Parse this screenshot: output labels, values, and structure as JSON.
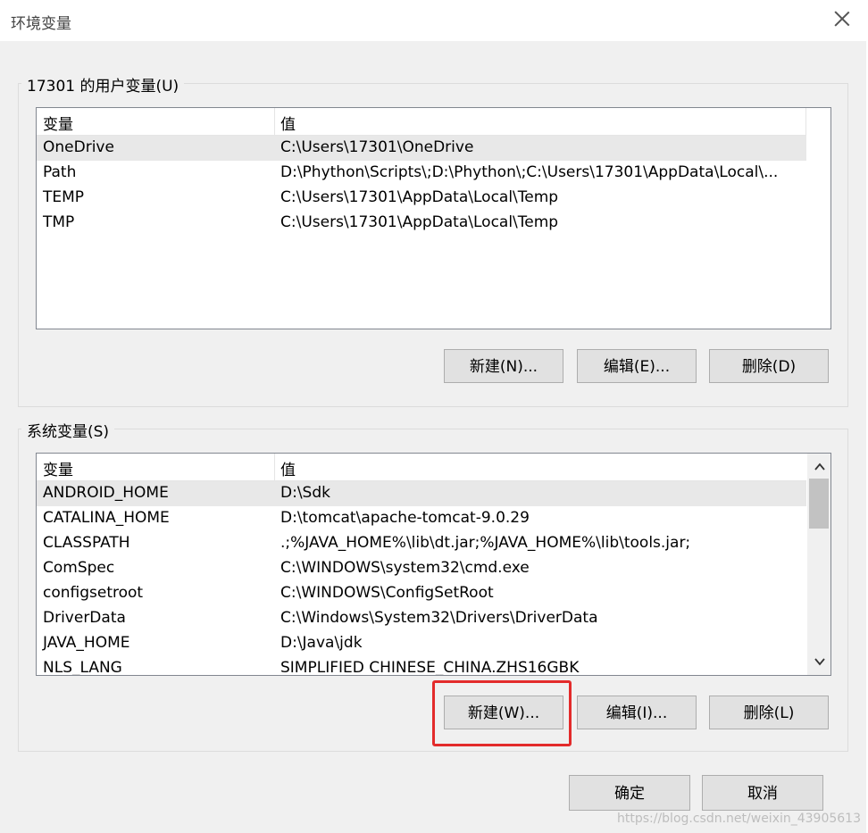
{
  "window": {
    "title": "环境变量"
  },
  "user_vars": {
    "group_label": "17301 的用户变量(U)",
    "col_name": "变量",
    "col_value": "值",
    "rows": [
      {
        "name": "OneDrive",
        "value": "C:\\Users\\17301\\OneDrive"
      },
      {
        "name": "Path",
        "value": "D:\\Phython\\Scripts\\;D:\\Phython\\;C:\\Users\\17301\\AppData\\Local\\..."
      },
      {
        "name": "TEMP",
        "value": "C:\\Users\\17301\\AppData\\Local\\Temp"
      },
      {
        "name": "TMP",
        "value": "C:\\Users\\17301\\AppData\\Local\\Temp"
      }
    ],
    "buttons": {
      "new": "新建(N)...",
      "edit": "编辑(E)...",
      "delete": "删除(D)"
    }
  },
  "system_vars": {
    "group_label": "系统变量(S)",
    "col_name": "变量",
    "col_value": "值",
    "rows": [
      {
        "name": "ANDROID_HOME",
        "value": "D:\\Sdk"
      },
      {
        "name": "CATALINA_HOME",
        "value": "D:\\tomcat\\apache-tomcat-9.0.29"
      },
      {
        "name": "CLASSPATH",
        "value": ".;%JAVA_HOME%\\lib\\dt.jar;%JAVA_HOME%\\lib\\tools.jar;"
      },
      {
        "name": "ComSpec",
        "value": "C:\\WINDOWS\\system32\\cmd.exe"
      },
      {
        "name": "configsetroot",
        "value": "C:\\WINDOWS\\ConfigSetRoot"
      },
      {
        "name": "DriverData",
        "value": "C:\\Windows\\System32\\Drivers\\DriverData"
      },
      {
        "name": "JAVA_HOME",
        "value": "D:\\Java\\jdk"
      },
      {
        "name": "NLS_LANG",
        "value": "SIMPLIFIED CHINESE_CHINA.ZHS16GBK"
      }
    ],
    "buttons": {
      "new": "新建(W)...",
      "edit": "编辑(I)...",
      "delete": "删除(L)"
    }
  },
  "footer": {
    "ok": "确定",
    "cancel": "取消"
  },
  "watermark": "https://blog.csdn.net/weixin_43905613",
  "icons": {
    "close": "close-icon",
    "scroll_up": "chevron-up-icon",
    "scroll_down": "chevron-down-icon"
  },
  "colors": {
    "highlight": "#e32b2b",
    "selected_row": "#e8e8e8"
  }
}
